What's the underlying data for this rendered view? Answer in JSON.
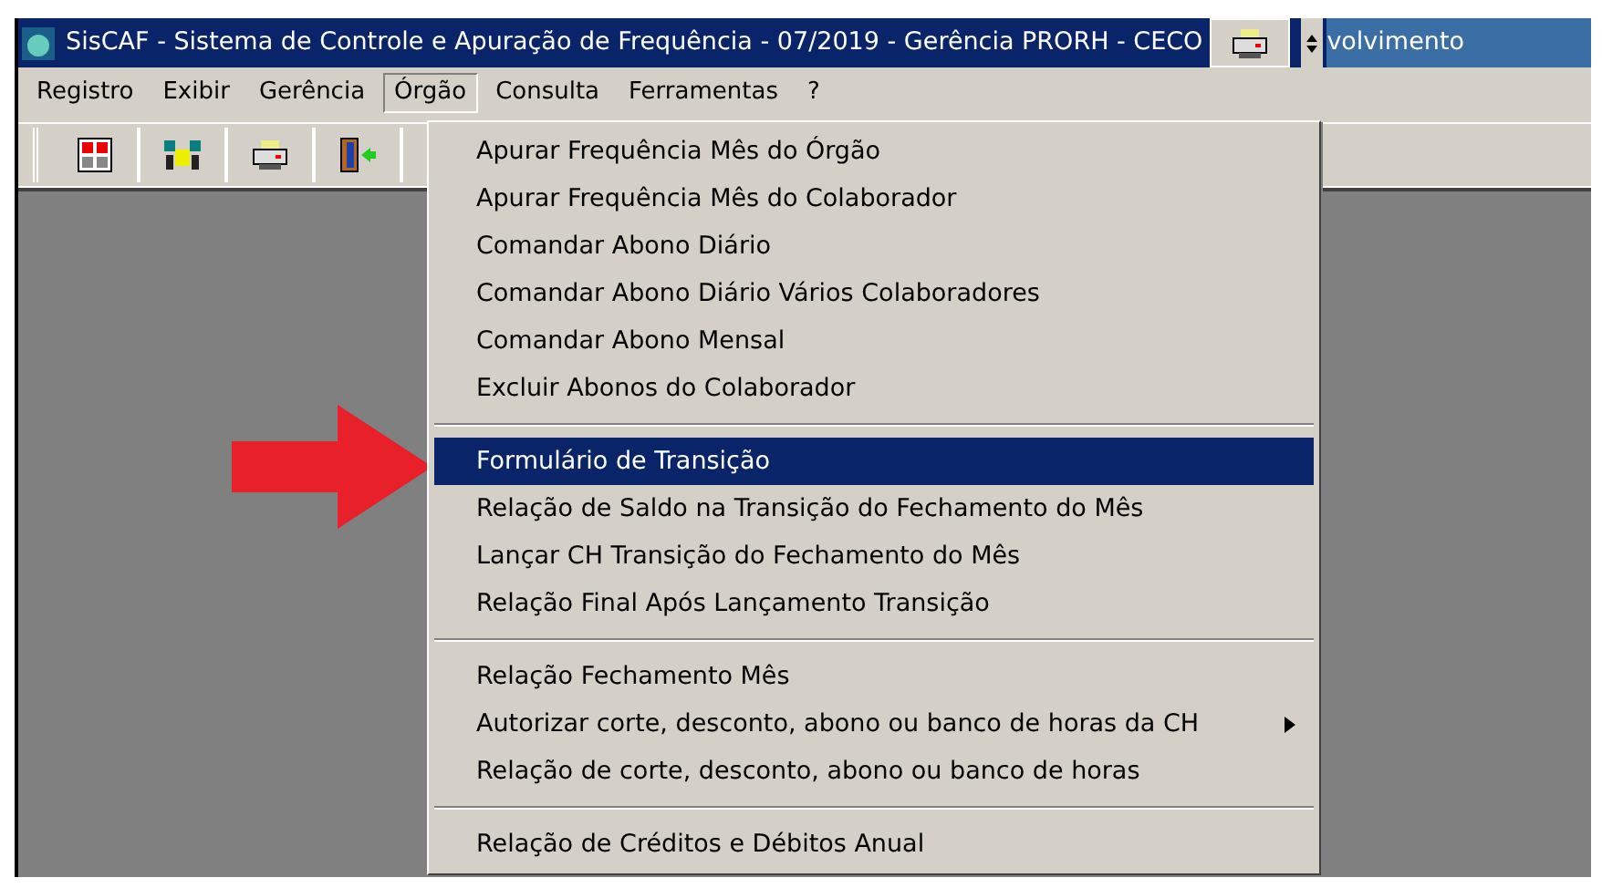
{
  "window": {
    "title": "SisCAF - Sistema de Controle e Apuração de Frequência - 07/2019 - Gerência PRORH - CECO",
    "overlap_text": "volvimento"
  },
  "menu_bar": [
    {
      "label": "Registro",
      "selected": false
    },
    {
      "label": "Exibir",
      "selected": false
    },
    {
      "label": "Gerência",
      "selected": false
    },
    {
      "label": "Órgão",
      "selected": true
    },
    {
      "label": "Consulta",
      "selected": false
    },
    {
      "label": "Ferramentas",
      "selected": false
    },
    {
      "label": "?",
      "selected": false
    }
  ],
  "toolbar": [
    {
      "kind": "calendar"
    },
    {
      "kind": "people"
    },
    {
      "kind": "printer"
    },
    {
      "kind": "exit"
    }
  ],
  "dropdown": {
    "sections": [
      {
        "items": [
          {
            "label": "Apurar Frequência Mês do Órgão",
            "selected": false,
            "submenu": false
          },
          {
            "label": "Apurar Frequência Mês do Colaborador",
            "selected": false,
            "submenu": false
          },
          {
            "label": "Comandar Abono Diário",
            "selected": false,
            "submenu": false
          },
          {
            "label": "Comandar Abono Diário Vários Colaboradores",
            "selected": false,
            "submenu": false
          },
          {
            "label": "Comandar Abono Mensal",
            "selected": false,
            "submenu": false
          },
          {
            "label": "Excluir Abonos do Colaborador",
            "selected": false,
            "submenu": false
          }
        ]
      },
      {
        "items": [
          {
            "label": "Formulário de Transição",
            "selected": true,
            "submenu": false
          },
          {
            "label": "Relação de Saldo na Transição do Fechamento do Mês",
            "selected": false,
            "submenu": false
          },
          {
            "label": "Lançar CH Transição do Fechamento do Mês",
            "selected": false,
            "submenu": false
          },
          {
            "label": "Relação Final Após Lançamento Transição",
            "selected": false,
            "submenu": false
          }
        ]
      },
      {
        "items": [
          {
            "label": "Relação Fechamento Mês",
            "selected": false,
            "submenu": false
          },
          {
            "label": "Autorizar corte, desconto, abono ou banco de horas da CH",
            "selected": false,
            "submenu": true
          },
          {
            "label": "Relação de corte, desconto, abono ou banco de horas",
            "selected": false,
            "submenu": false
          }
        ]
      },
      {
        "items": [
          {
            "label": "Relação de Créditos e Débitos Anual",
            "selected": false,
            "submenu": false
          }
        ]
      }
    ]
  }
}
